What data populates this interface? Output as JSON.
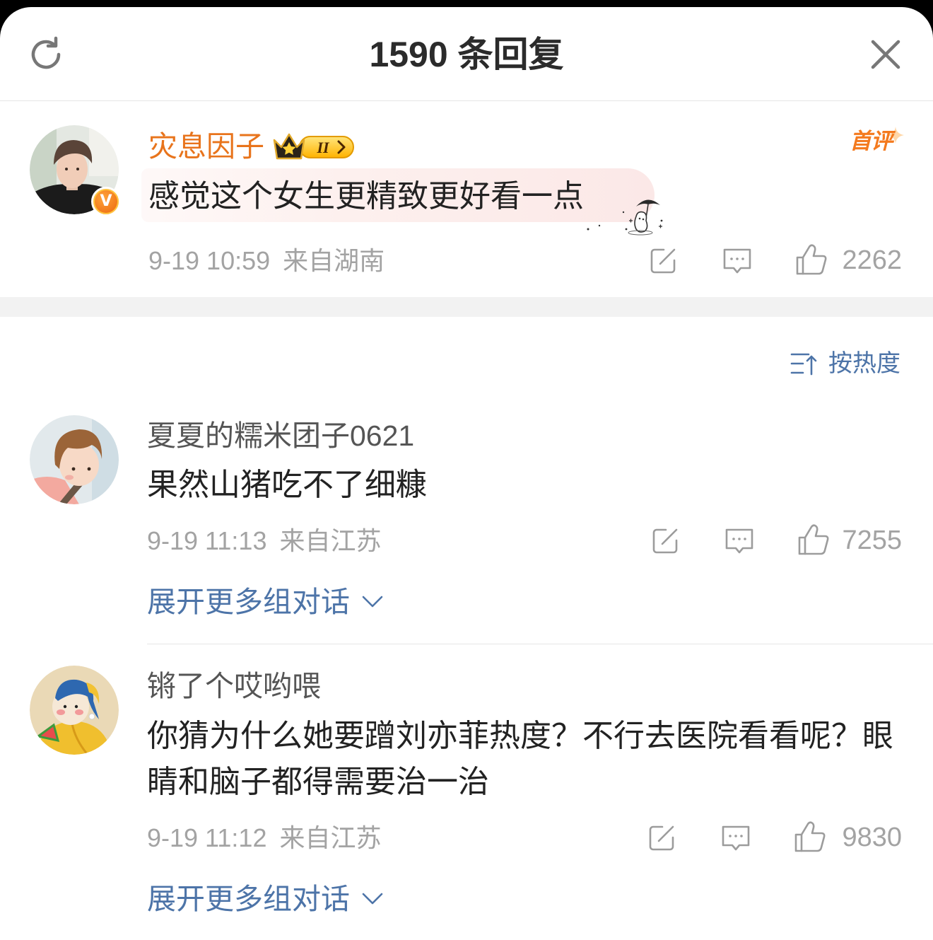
{
  "header": {
    "title": "1590 条回复"
  },
  "root_comment": {
    "username": "灾息因子",
    "verified_mark": "V",
    "level_badge": "II",
    "first_comment_badge": "首评",
    "text": "感觉这个女生更精致更好看一点",
    "time": "9-19 10:59",
    "location": "来自湖南",
    "likes": "2262"
  },
  "sort": {
    "label": "按热度"
  },
  "replies": [
    {
      "username": "夏夏的糯米团子0621",
      "text": "果然山猪吃不了细糠",
      "time": "9-19 11:13",
      "location": "来自江苏",
      "likes": "7255",
      "expand_label": "展开更多组对话"
    },
    {
      "username": "锵了个哎哟喂",
      "text": "你猜为什么她要蹭刘亦菲热度？不行去医院看看呢？眼睛和脑子都得需要治一治",
      "time": "9-19 11:12",
      "location": "来自江苏",
      "likes": "9830",
      "expand_label": "展开更多组对话"
    }
  ],
  "icons": {
    "refresh": "refresh-icon",
    "close": "close-icon",
    "share": "share-icon",
    "comment": "comment-icon",
    "like": "thumbs-up-icon",
    "sort": "sort-icon",
    "expand": "chevron-down-icon",
    "verified": "verified-badge-icon",
    "level": "crown-level-badge-icon",
    "first_comment_star": "sparkle-icon",
    "sticker": "umbrella-sticker"
  },
  "colors": {
    "title": "#2b2b2b",
    "header_icon": "#777777",
    "accent": "#e8741c",
    "accent2": "#f47a1e",
    "text": "#222222",
    "name": "#555555",
    "meta": "#a3a3a3",
    "icon": "#9c9c9c",
    "link": "#4d74a8",
    "divider": "#e6e6e6",
    "band": "#f2f2f2"
  }
}
